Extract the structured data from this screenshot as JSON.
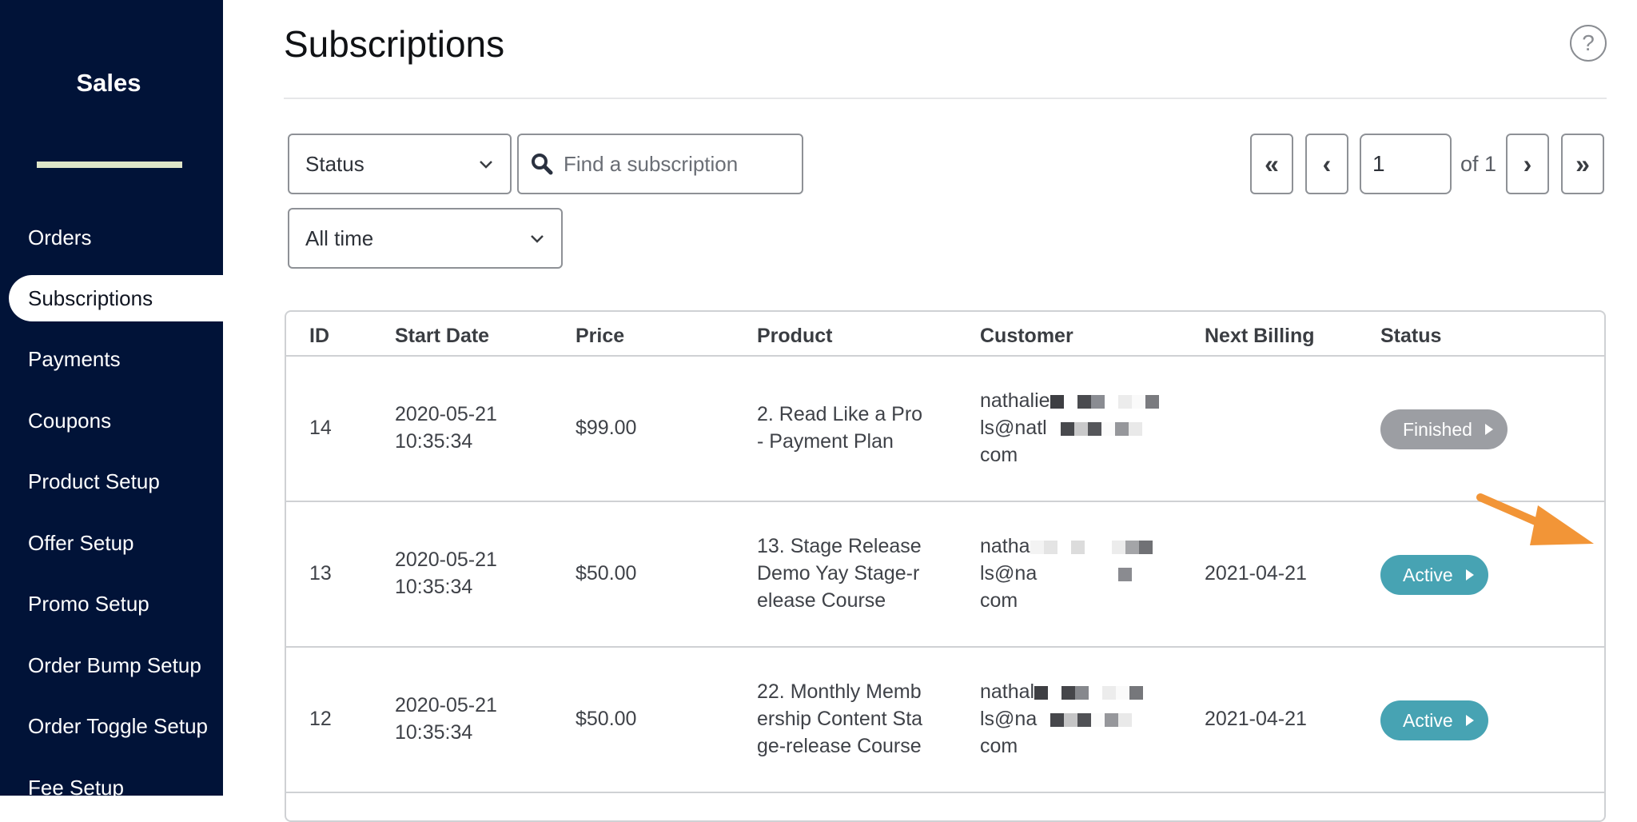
{
  "sidebar": {
    "title": "Sales",
    "items": [
      {
        "label": "Orders",
        "active": false
      },
      {
        "label": "Subscriptions",
        "active": true
      },
      {
        "label": "Payments",
        "active": false
      },
      {
        "label": "Coupons",
        "active": false
      },
      {
        "label": "Product Setup",
        "active": false
      },
      {
        "label": "Offer Setup",
        "active": false
      },
      {
        "label": "Promo Setup",
        "active": false
      },
      {
        "label": "Order Bump Setup",
        "active": false
      },
      {
        "label": "Order Toggle Setup",
        "active": false
      },
      {
        "label": "Fee Setup",
        "active": false
      }
    ]
  },
  "header": {
    "title": "Subscriptions",
    "help_icon": "question-circle-icon",
    "help_label": "?"
  },
  "filters": {
    "status_select": {
      "value": "Status"
    },
    "time_select": {
      "value": "All time"
    },
    "search": {
      "placeholder": "Find a subscription",
      "value": "",
      "icon": "search-icon"
    }
  },
  "pagination": {
    "first_label": "«",
    "prev_label": "‹",
    "current_page": "1",
    "of_label": "of 1",
    "next_label": "›",
    "last_label": "»"
  },
  "table": {
    "columns": [
      "ID",
      "Start Date",
      "Price",
      "Product",
      "Customer",
      "Next Billing",
      "Status"
    ],
    "rows": [
      {
        "id": "14",
        "start_date": [
          "2020-05-21",
          "10:35:34"
        ],
        "price": "$99.00",
        "product": [
          "2. Read Like a Pro",
          "- Payment Plan"
        ],
        "customer": [
          "nathalie",
          "ls@natl",
          "com"
        ],
        "next_billing": "",
        "status": "Finished"
      },
      {
        "id": "13",
        "start_date": [
          "2020-05-21",
          "10:35:34"
        ],
        "price": "$50.00",
        "product": [
          "13. Stage Release",
          "Demo Yay Stage-r",
          "elease Course"
        ],
        "customer": [
          "natha",
          "ls@na",
          "com"
        ],
        "next_billing": "2021-04-21",
        "status": "Active"
      },
      {
        "id": "12",
        "start_date": [
          "2020-05-21",
          "10:35:34"
        ],
        "price": "$50.00",
        "product": [
          "22. Monthly Memb",
          "ership Content Sta",
          "ge-release Course"
        ],
        "customer": [
          "nathal",
          "ls@na",
          "com"
        ],
        "next_billing": "2021-04-21",
        "status": "Active"
      }
    ]
  },
  "colors": {
    "sidebar_bg": "#011338",
    "sidebar_divider": "#dfe5c8",
    "status_active": "#47a3b3",
    "status_finished": "#9c9ea3",
    "annotation_arrow": "#f29537"
  }
}
